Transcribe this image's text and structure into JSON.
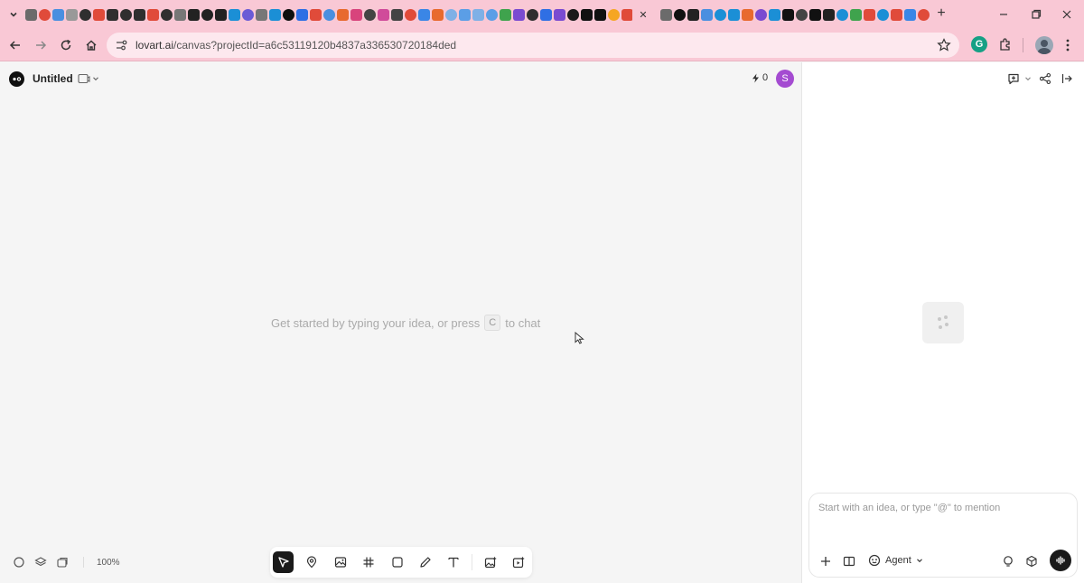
{
  "browser": {
    "favicons_a": [
      "#6b6b6b",
      "#e04b3a",
      "#4a8fe0",
      "#999999",
      "#2f2f2f",
      "#e04b3a",
      "#2f2f2f",
      "#2f2f2f",
      "#2f2f2f",
      "#e04b3a",
      "#2f2f2f",
      "#777777",
      "#222222",
      "#222222",
      "#222222",
      "#1b8fd6",
      "#6a5bd6",
      "#777777",
      "#1b8fd6",
      "#0f0f0f",
      "#2f6fe4",
      "#e04b3a",
      "#4a8fe0",
      "#e86a2e",
      "#d8447c",
      "#444444",
      "#d04b9a",
      "#444444",
      "#e04b3a",
      "#3a86e6",
      "#e86a2e",
      "#7fb0e6",
      "#5b9ee6",
      "#7fb0e6",
      "#5b9ee6",
      "#3fa34d",
      "#7a4bd1",
      "#2f2f2f",
      "#2f6fe4",
      "#7a4bd1",
      "#1a1a1a",
      "#111111",
      "#111111",
      "#f5a623",
      "#e04b3a",
      "#ea4335",
      "#3fa34d",
      "#111111",
      "#111111",
      "#111111",
      "#111111",
      "#f8d7e0",
      "#f8d7e0",
      "#f8d7e0",
      "#111111",
      "#3a86e6",
      "#1a73e8",
      "#3a86e6",
      "#3a86e6",
      "#222222",
      "#222222",
      "#222222",
      "#1a1a1a"
    ],
    "favicons_b": [
      "#6b6b6b",
      "#111111",
      "#222222",
      "#4a8fe0",
      "#1b8fd6",
      "#1b8fd6",
      "#e86a2e",
      "#7a4bd1",
      "#1b8fd6",
      "#111111",
      "#444444",
      "#111111",
      "#222222",
      "#1b8fd6",
      "#3fa34d",
      "#e04b3a",
      "#1b8fd6",
      "#e04b3a",
      "#3a86e6",
      "#e04b3a",
      "#3fa34d",
      "#f5a623",
      "#3fa34d"
    ],
    "url_domain": "lovart.ai",
    "url_path": "/canvas?projectId=a6c53119120b4837a336530720184ded"
  },
  "app": {
    "title": "Untitled",
    "credits": "0",
    "avatar_initial": "S",
    "hint_before": "Get started by typing your idea, or press",
    "hint_key": "C",
    "hint_after": "to chat",
    "zoom": "100%"
  },
  "chat": {
    "placeholder": "Start with an idea, or type \"@\" to mention",
    "agent_label": "Agent"
  },
  "colors": {
    "browser_chrome": "#f9c8d5",
    "omnibox": "#fde8ee",
    "canvas_bg": "#f5f5f5",
    "active_tool": "#1a1a1a",
    "avatar": "#a44bd1",
    "grammarly": "#16a085"
  }
}
